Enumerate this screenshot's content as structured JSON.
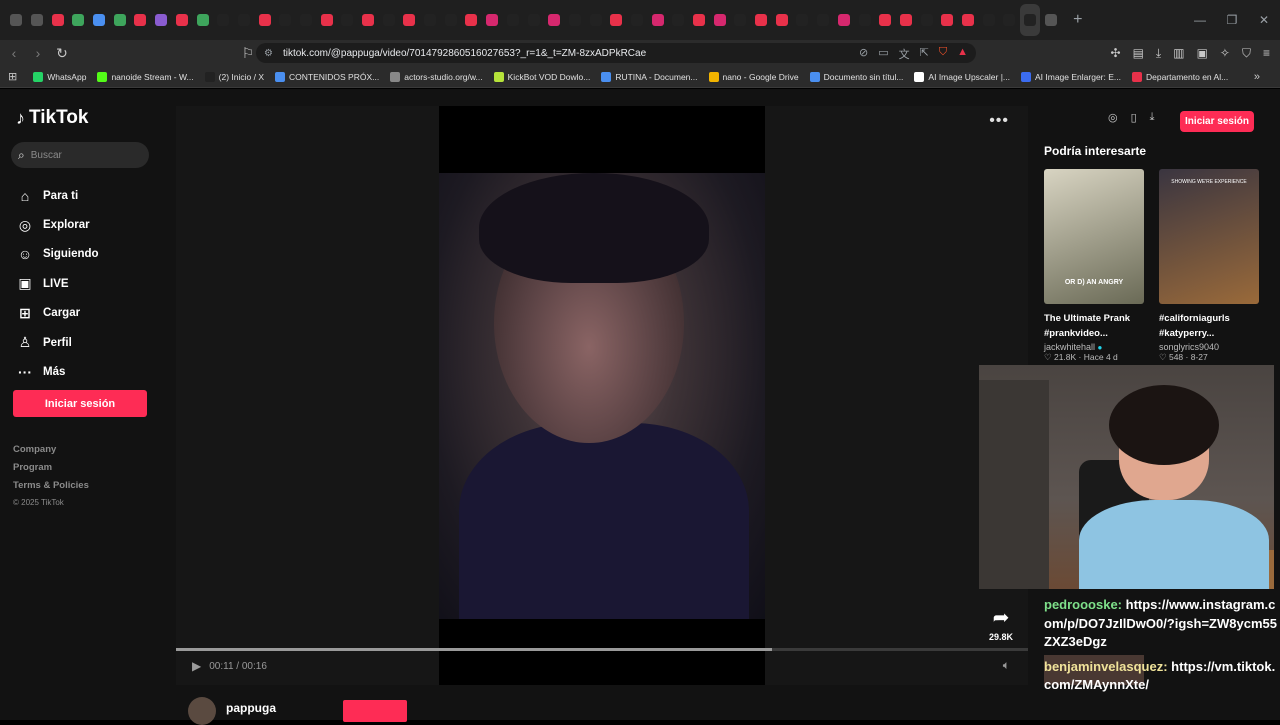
{
  "browser": {
    "url": "tiktok.com/@pappuga/video/7014792860516027653?_r=1&_t=ZM-8zxADPkRCae",
    "tabs": [
      {
        "c": "#555"
      },
      {
        "c": "#555"
      },
      {
        "c": "#e8314a"
      },
      {
        "c": "#3ea55c"
      },
      {
        "c": "#4a8ff0"
      },
      {
        "c": "#3ea55c"
      },
      {
        "c": "#e8314a"
      },
      {
        "c": "#8a5cd0"
      },
      {
        "c": "#e8314a"
      },
      {
        "c": "#3ea55c"
      },
      {
        "c": "#222"
      },
      {
        "c": "#222"
      },
      {
        "c": "#e8314a"
      },
      {
        "c": "#222"
      },
      {
        "c": "#222"
      },
      {
        "c": "#e8314a"
      },
      {
        "c": "#222"
      },
      {
        "c": "#e8314a"
      },
      {
        "c": "#222"
      },
      {
        "c": "#e8314a"
      },
      {
        "c": "#222"
      },
      {
        "c": "#222"
      },
      {
        "c": "#e8314a"
      },
      {
        "c": "#d6286e"
      },
      {
        "c": "#222"
      },
      {
        "c": "#222"
      },
      {
        "c": "#d6286e"
      },
      {
        "c": "#222"
      },
      {
        "c": "#222"
      },
      {
        "c": "#e8314a"
      },
      {
        "c": "#222"
      },
      {
        "c": "#d6286e"
      },
      {
        "c": "#222"
      },
      {
        "c": "#e8314a"
      },
      {
        "c": "#d6286e"
      },
      {
        "c": "#222"
      },
      {
        "c": "#e8314a"
      },
      {
        "c": "#e8314a"
      },
      {
        "c": "#222"
      },
      {
        "c": "#222"
      },
      {
        "c": "#d6286e"
      },
      {
        "c": "#222"
      },
      {
        "c": "#e8314a"
      },
      {
        "c": "#e8314a"
      },
      {
        "c": "#222"
      },
      {
        "c": "#e8314a"
      },
      {
        "c": "#e8314a"
      },
      {
        "c": "#222"
      },
      {
        "c": "#222"
      },
      {
        "c": "#222"
      },
      {
        "c": "#555"
      }
    ],
    "bookmarks": [
      {
        "label": "WhatsApp",
        "color": "#25d366"
      },
      {
        "label": "nanoide Stream - W...",
        "color": "#53fc18"
      },
      {
        "label": "(2) Inicio / X",
        "color": "#222"
      },
      {
        "label": "CONTENIDOS PRÓX...",
        "color": "#4a8ff0"
      },
      {
        "label": "actors-studio.org/w...",
        "color": "#888"
      },
      {
        "label": "KickBot VOD Dowlo...",
        "color": "#b6e33a"
      },
      {
        "label": "RUTINA - Documen...",
        "color": "#4a8ff0"
      },
      {
        "label": "nano - Google Drive",
        "color": "#f2b400"
      },
      {
        "label": "Documento sin títul...",
        "color": "#4a8ff0"
      },
      {
        "label": "AI Image Upscaler |...",
        "color": "#fff"
      },
      {
        "label": "AI Image Enlarger: E...",
        "color": "#3b6cf0"
      },
      {
        "label": "Departamento en Al...",
        "color": "#e8314a"
      }
    ]
  },
  "sidebar": {
    "brand": "TikTok",
    "search_placeholder": "Buscar",
    "nav": [
      {
        "icon": "⌂",
        "label": "Para ti",
        "name": "home"
      },
      {
        "icon": "◎",
        "label": "Explorar",
        "name": "explore"
      },
      {
        "icon": "☺",
        "label": "Siguiendo",
        "name": "following"
      },
      {
        "icon": "▣",
        "label": "LIVE",
        "name": "live"
      },
      {
        "icon": "⊞",
        "label": "Cargar",
        "name": "upload"
      },
      {
        "icon": "♙",
        "label": "Perfil",
        "name": "profile"
      },
      {
        "icon": "···",
        "label": "Más",
        "name": "more"
      }
    ],
    "login_label": "Iniciar sesión",
    "footer": {
      "company": "Company",
      "program": "Program",
      "terms": "Terms & Policies",
      "copyright": "© 2025 TikTok"
    }
  },
  "video": {
    "time": "00:11 / 00:16",
    "progress": 0.7,
    "share_count": "29.8K",
    "author": "pappuga"
  },
  "right": {
    "login_label": "Iniciar sesión",
    "section_title": "Podría interesarte",
    "recs": [
      {
        "caption": "OR D) AN ANGRY",
        "title1": "The Ultimate Prank",
        "title2": "#prankvideo...",
        "author": "jackwhitehall",
        "stats": "♡ 21.8K · Hace 4 d",
        "colors": [
          "#d8d4c2",
          "#6a6a56"
        ]
      },
      {
        "caption": "",
        "top": "SHOWING WE'RE EXPERIENCE",
        "title1": "#californiagurls",
        "title2": "#katyperry...",
        "author": "songlyrics9040",
        "stats": "♡ 548 · 8-27",
        "colors": [
          "#3a3540",
          "#9a6a3a"
        ]
      }
    ]
  },
  "chat": [
    {
      "user": "pedroooske:",
      "msg": "https://www.instagram.com/p/DO7JzIlDwO0/?igsh=ZW8ycm55ZXZ3eDgz",
      "cls": "u1"
    },
    {
      "user": "benjaminvelasquez:",
      "msg": "https://vm.tiktok.com/ZMAynnXte/",
      "cls": "u2"
    }
  ]
}
